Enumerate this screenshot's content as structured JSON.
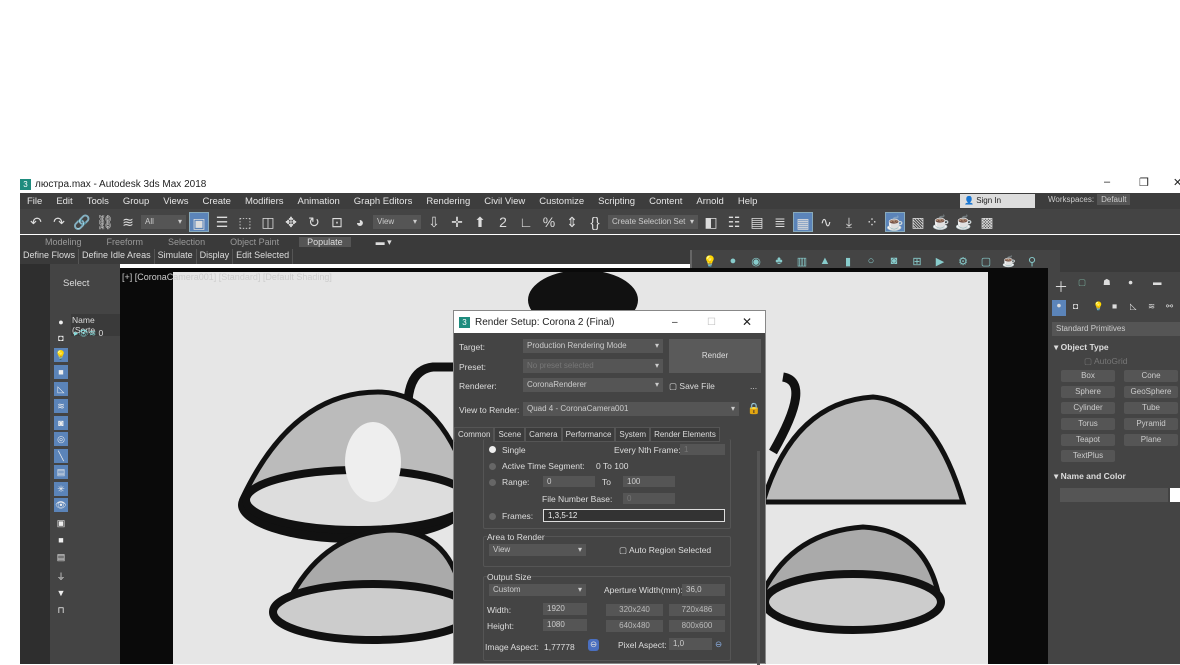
{
  "window": {
    "title": "люстра.max - Autodesk 3ds Max 2018",
    "logo": "3",
    "minimize": "–",
    "maximize": "❐",
    "close": "✕"
  },
  "menu": [
    "File",
    "Edit",
    "Tools",
    "Group",
    "Views",
    "Create",
    "Modifiers",
    "Animation",
    "Graph Editors",
    "Rendering",
    "Civil View",
    "Customize",
    "Scripting",
    "Content",
    "Arnold",
    "Help"
  ],
  "account": {
    "sign_in": "Sign In",
    "workspaces_label": "Workspaces:",
    "workspace": "Default"
  },
  "toolbar": {
    "filter": "All",
    "ref_coord": "View",
    "selection_set": "Create Selection Set"
  },
  "ribbon": {
    "tabs": [
      "Modeling",
      "Freeform",
      "Selection",
      "Object Paint",
      "Populate"
    ],
    "active": "Populate",
    "row": [
      "Define Flows",
      "Define Idle Areas",
      "Simulate",
      "Display",
      "Edit Selected"
    ]
  },
  "explorer": {
    "select": "Select",
    "column": "Name (Sorte",
    "layer": "0"
  },
  "viewport": {
    "label": "[+] [CoronaCamera001] [Standard] [Default Shading]"
  },
  "command_panel": {
    "category": "Standard Primitives",
    "object_type": "Object Type",
    "autogrid": "AutoGrid",
    "primitives": [
      "Box",
      "Cone",
      "Sphere",
      "GeoSphere",
      "Cylinder",
      "Tube",
      "Torus",
      "Pyramid",
      "Teapot",
      "Plane",
      "TextPlus"
    ],
    "name_color": "Name and Color"
  },
  "dialog": {
    "title": "Render Setup: Corona 2 (Final)",
    "target_label": "Target:",
    "target": "Production Rendering Mode",
    "preset_label": "Preset:",
    "preset": "No preset selected",
    "renderer_label": "Renderer:",
    "renderer": "CoronaRenderer",
    "render_button": "Render",
    "save_file": "Save File",
    "more": "...",
    "view_label": "View to Render:",
    "view": "Quad 4 - CoronaCamera001",
    "tabs": [
      "Common",
      "Scene",
      "Camera",
      "Performance",
      "System",
      "Render Elements"
    ],
    "single": "Single",
    "every_nth": "Every Nth Frame:",
    "every_nth_value": "1",
    "active_seg": "Active Time Segment:",
    "active_seg_value": "0 To 100",
    "range": "Range:",
    "range_from": "0",
    "range_to_label": "To",
    "range_to": "100",
    "file_base": "File Number Base:",
    "file_base_value": "0",
    "frames": "Frames:",
    "frames_value": "1,3,5-12",
    "area_title": "Area to Render",
    "area": "View",
    "auto_region": "Auto Region Selected",
    "output_title": "Output Size",
    "output": "Custom",
    "aperture_label": "Aperture Width(mm):",
    "aperture": "36,0",
    "width_label": "Width:",
    "width": "1920",
    "height_label": "Height:",
    "height": "1080",
    "presets": [
      "320x240",
      "720x486",
      "640x480",
      "800x600"
    ],
    "image_aspect_label": "Image Aspect:",
    "image_aspect": "1,77778",
    "pixel_aspect_label": "Pixel Aspect:",
    "pixel_aspect": "1,0"
  }
}
